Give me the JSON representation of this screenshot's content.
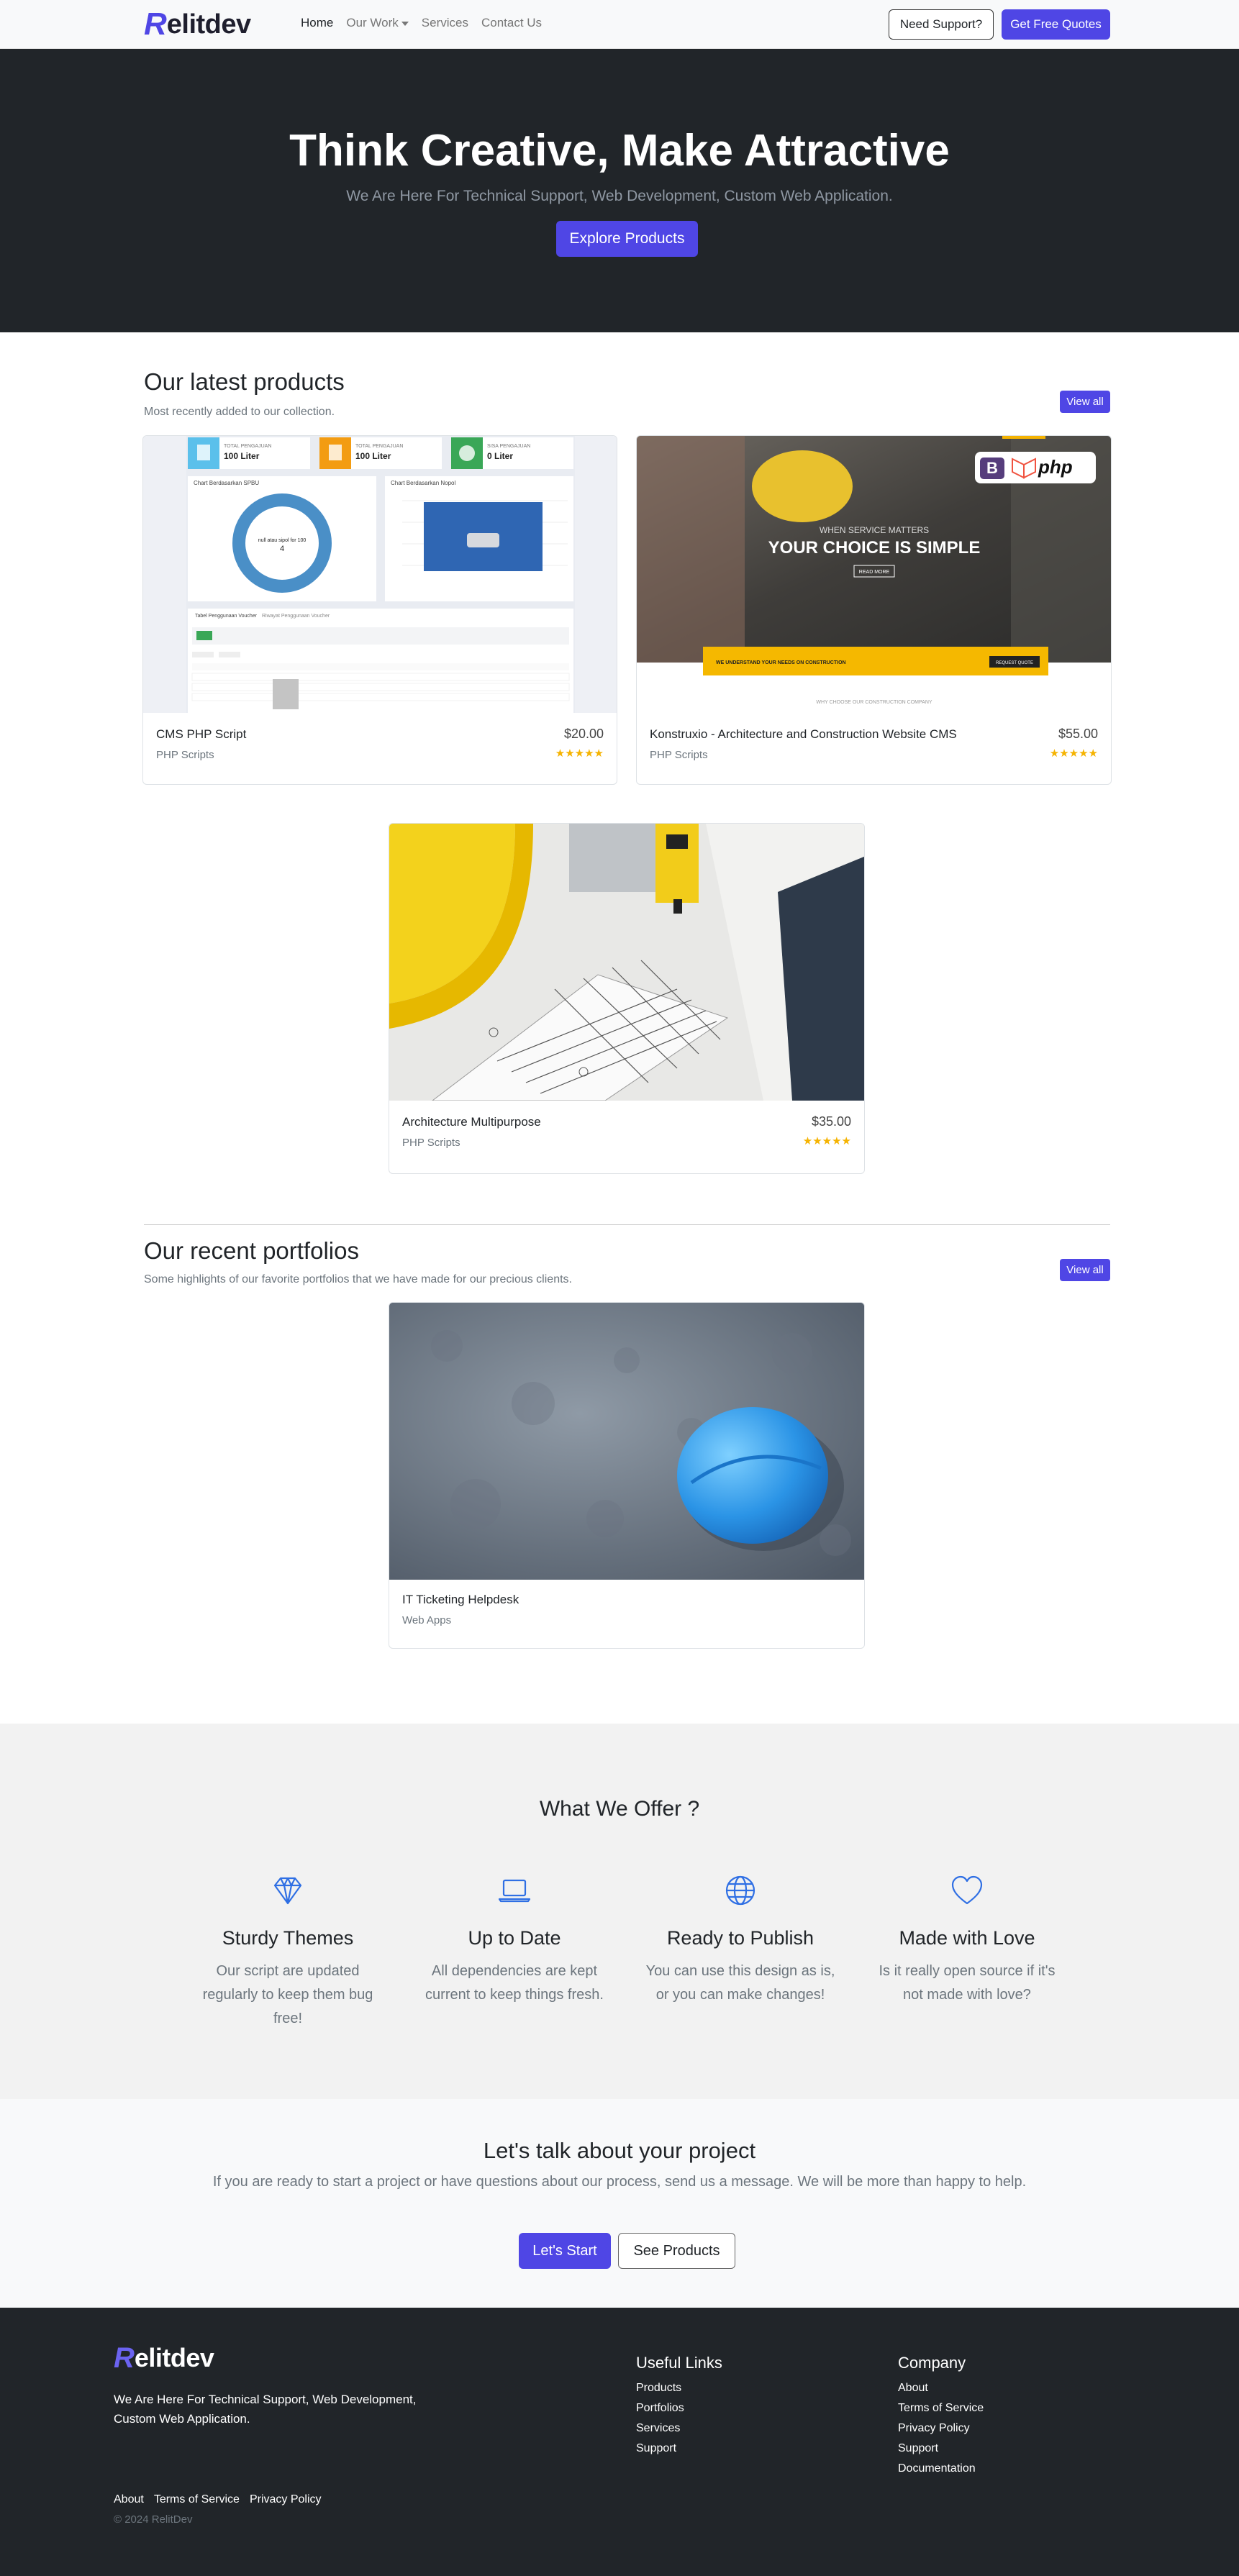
{
  "nav": {
    "brand_mark": "R",
    "brand_text": "elitdev",
    "links": [
      {
        "label": "Home",
        "active": true
      },
      {
        "label": "Our Work",
        "dropdown": true
      },
      {
        "label": "Services"
      },
      {
        "label": "Contact Us"
      }
    ],
    "support_label": "Need Support?",
    "quote_label": "Get Free Quotes"
  },
  "hero": {
    "title": "Think Creative, Make Attractive",
    "subtitle": "We Are Here For Technical Support, Web Development, Custom Web Application.",
    "cta_label": "Explore Products"
  },
  "products": {
    "title": "Our latest products",
    "subtitle": "Most recently added to our collection.",
    "view_all": "View all",
    "items": [
      {
        "name": "CMS PHP Script",
        "category": "PHP Scripts",
        "price": "$20.00",
        "rating": 5,
        "stars": "★★★★★"
      },
      {
        "name": "Konstruxio - Architecture and Construction Website CMS",
        "category": "PHP Scripts",
        "price": "$55.00",
        "rating": 5,
        "stars": "★★★★★"
      },
      {
        "name": "Architecture Multipurpose",
        "category": "PHP Scripts",
        "price": "$35.00",
        "rating": 5,
        "stars": "★★★★★"
      }
    ],
    "thumb1": {
      "stat1_label": "TOTAL PENGAJUAN",
      "stat1_value": "100 Liter",
      "stat2_label": "TOTAL PENGAJUAN",
      "stat2_value": "100 Liter",
      "stat3_label": "SISA PENGAJUAN",
      "stat3_value": "0 Liter",
      "chart1_title": "Chart Berdasarkan SPBU",
      "chart2_title": "Chart Berdasarkan Nopol",
      "donut_text": "null atau sipol for 100",
      "donut_value": "4",
      "tab1": "Tabel Penggunaan Voucher",
      "tab2": "Riwayat Penggunaan Voucher"
    },
    "thumb2": {
      "tagline": "WHEN SERVICE MATTERS",
      "headline": "YOUR CHOICE IS SIMPLE",
      "read_more": "READ MORE",
      "banner": "WE UNDERSTAND YOUR NEEDS ON CONSTRUCTION",
      "request": "REQUEST QUOTE",
      "footer_text": "WHY CHOOSE OUR CONSTRUCTION COMPANY",
      "badge_b": "B",
      "badge_php": "php"
    }
  },
  "portfolios": {
    "title": "Our recent portfolios",
    "subtitle": "Some highlights of our favorite portfolios that we have made for our precious clients.",
    "view_all": "View all",
    "items": [
      {
        "name": "IT Ticketing Helpdesk",
        "category": "Web Apps"
      }
    ]
  },
  "offer": {
    "title": "What We Offer ?",
    "features": [
      {
        "icon": "diamond-icon",
        "title": "Sturdy Themes",
        "text": "Our script are updated regularly to keep them bug free!"
      },
      {
        "icon": "laptop-icon",
        "title": "Up to Date",
        "text": "All dependencies are kept current to keep things fresh."
      },
      {
        "icon": "globe-icon",
        "title": "Ready to Publish",
        "text": "You can use this design as is, or you can make changes!"
      },
      {
        "icon": "heart-icon",
        "title": "Made with Love",
        "text": "Is it really open source if it's not made with love?"
      }
    ]
  },
  "cta": {
    "title": "Let's talk about your project",
    "text": "If you are ready to start a project or have questions about our process, send us a message. We will be more than happy to help.",
    "start_label": "Let's Start",
    "products_label": "See Products"
  },
  "footer": {
    "brand_mark": "R",
    "brand_text": "elitdev",
    "tagline": "We Are Here For Technical Support, Web Development, Custom Web Application.",
    "useful_title": "Useful Links",
    "useful_links": [
      "Products",
      "Portfolios",
      "Services",
      "Support"
    ],
    "company_title": "Company",
    "company_links": [
      "About",
      "Terms of Service",
      "Privacy Policy",
      "Support",
      "Documentation"
    ],
    "bottom_links": [
      "About",
      "Terms of Service",
      "Privacy Policy"
    ],
    "copyright": "© 2024 RelitDev"
  },
  "colors": {
    "primary": "#4f46e5",
    "dark": "#212529",
    "star": "#f5b301",
    "muted": "#6c757d",
    "icon_blue": "#2f6fe4"
  }
}
